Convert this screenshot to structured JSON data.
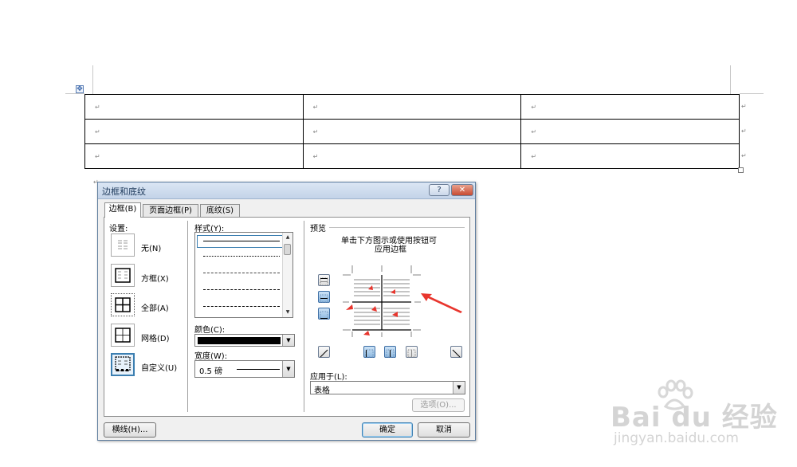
{
  "document": {
    "cell_mark": "↵",
    "anchor_symbol": "✥",
    "rows": 3,
    "cols": 3
  },
  "dialog": {
    "title": "边框和底纹",
    "help_label": "?",
    "close_label": "✕",
    "tabs": [
      {
        "label": "边框(B)",
        "active": true
      },
      {
        "label": "页面边框(P)",
        "active": false
      },
      {
        "label": "底纹(S)",
        "active": false
      }
    ],
    "settings": {
      "heading": "设置:",
      "items": [
        {
          "label": "无(N)",
          "icon": "none-border-icon"
        },
        {
          "label": "方框(X)",
          "icon": "box-border-icon"
        },
        {
          "label": "全部(A)",
          "icon": "all-borders-icon"
        },
        {
          "label": "网格(D)",
          "icon": "grid-border-icon"
        },
        {
          "label": "自定义(U)",
          "icon": "custom-border-icon",
          "selected": true
        }
      ]
    },
    "style": {
      "heading": "样式(Y):",
      "options": [
        "solid",
        "dotted",
        "dashed-small",
        "dashed",
        "dash-dot"
      ]
    },
    "color": {
      "heading": "颜色(C):",
      "value": "#000000"
    },
    "width": {
      "heading": "宽度(W):",
      "value": "0.5 磅"
    },
    "preview": {
      "heading": "预览",
      "instruction_line1": "单击下方图示或使用按钮可",
      "instruction_line2": "应用边框"
    },
    "apply_to": {
      "heading": "应用于(L):",
      "value": "表格"
    },
    "options_button": "选项(O)...",
    "hline_button": "横线(H)...",
    "ok_button": "确定",
    "cancel_button": "取消"
  },
  "watermark": {
    "brand": "Bai du 经验",
    "url": "jingyan.baidu.com"
  },
  "colors": {
    "accent": "#3c7fb1",
    "arrow": "#e8352d"
  }
}
